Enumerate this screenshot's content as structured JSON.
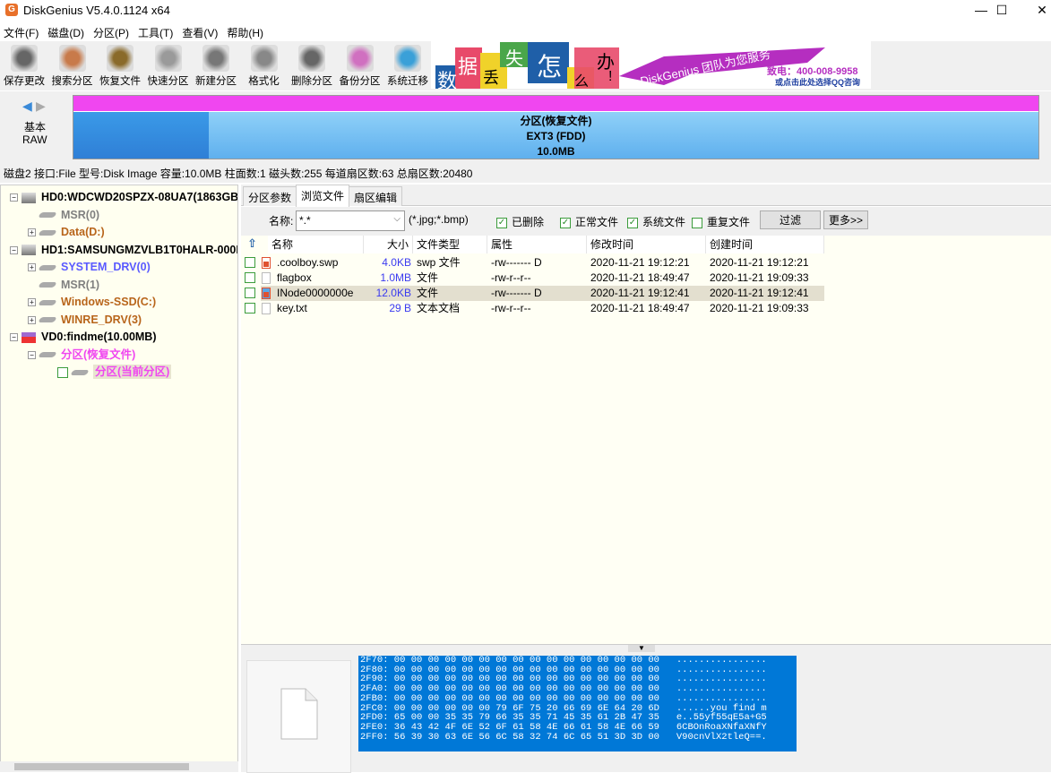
{
  "window": {
    "title": "DiskGenius V5.4.0.1124 x64",
    "logo": "G",
    "minimize": "—",
    "maximize": "☐",
    "close": "✕"
  },
  "menu": [
    "文件(F)",
    "磁盘(D)",
    "分区(P)",
    "工具(T)",
    "查看(V)",
    "帮助(H)"
  ],
  "toolbar": [
    {
      "label": "保存更改",
      "icon": "save-icon",
      "color": "#666"
    },
    {
      "label": "搜索分区",
      "icon": "search-icon",
      "color": "#c87a4a"
    },
    {
      "label": "恢复文件",
      "icon": "recover-icon",
      "color": "#8a6a2a"
    },
    {
      "label": "快速分区",
      "icon": "quick-partition-icon",
      "color": "#9a9a9a"
    },
    {
      "label": "新建分区",
      "icon": "new-partition-icon",
      "color": "#777"
    },
    {
      "label": "格式化",
      "icon": "format-icon",
      "color": "#888"
    },
    {
      "label": "删除分区",
      "icon": "delete-partition-icon",
      "color": "#666"
    },
    {
      "label": "备份分区",
      "icon": "backup-icon",
      "color": "#d070c0"
    },
    {
      "label": "系统迁移",
      "icon": "migrate-icon",
      "color": "#3aa0d8"
    }
  ],
  "banner": {
    "chars": [
      "数",
      "据",
      "丢",
      "失",
      "怎",
      "么",
      "办",
      "!"
    ],
    "slogan": "DiskGenius 团队为您服务",
    "phone": "致电：400-008-9958",
    "qq": "或点击此处选择QQ咨询"
  },
  "diskmap": {
    "type_line1": "基本",
    "type_line2": "RAW",
    "partition": "分区(恢复文件)",
    "fs": "EXT3 (FDD)",
    "size": "10.0MB",
    "color_strip": "#f046f0"
  },
  "diskinfo": "磁盘2 接口:File  型号:Disk Image  容量:10.0MB  柱面数:1  磁头数:255  每道扇区数:63  总扇区数:20480",
  "tree": [
    {
      "label": "HD0:WDCWD20SPZX-08UA7(1863GB)",
      "kind": "disk",
      "color": "#000"
    },
    {
      "label": "MSR(0)",
      "kind": "part",
      "color": "#808080"
    },
    {
      "label": "Data(D:)",
      "kind": "part",
      "color": "#b8651b"
    },
    {
      "label": "HD1:SAMSUNGMZVLB1T0HALR-000L7",
      "kind": "disk",
      "color": "#000"
    },
    {
      "label": "SYSTEM_DRV(0)",
      "kind": "part",
      "color": "#5a5aff"
    },
    {
      "label": "MSR(1)",
      "kind": "part",
      "color": "#808080"
    },
    {
      "label": "Windows-SSD(C:)",
      "kind": "part",
      "color": "#b8651b"
    },
    {
      "label": "WINRE_DRV(3)",
      "kind": "part",
      "color": "#b8651b"
    },
    {
      "label": "VD0:findme(10.00MB)",
      "kind": "vdisk",
      "color": "#000"
    },
    {
      "label": "分区(恢复文件)",
      "kind": "part",
      "color": "#f046f0"
    },
    {
      "label": "分区(当前分区)",
      "kind": "part",
      "color": "#f046f0"
    }
  ],
  "tabs": [
    "分区参数",
    "浏览文件",
    "扇区编辑"
  ],
  "filter": {
    "name_label": "名称:",
    "name_value": "*.*",
    "hint": "(*.jpg;*.bmp)",
    "checks": [
      {
        "label": "已删除",
        "checked": true
      },
      {
        "label": "正常文件",
        "checked": true
      },
      {
        "label": "系统文件",
        "checked": true
      },
      {
        "label": "重复文件",
        "checked": false
      }
    ],
    "filter_btn": "过滤",
    "more_btn": "更多>>"
  },
  "columns": [
    "名称",
    "大小",
    "文件类型",
    "属性",
    "修改时间",
    "创建时间"
  ],
  "files": [
    {
      "name": ".coolboy.swp",
      "size": "4.0KB",
      "type": "swp 文件",
      "attr": "-rw------- D",
      "mtime": "2020-11-21 19:12:21",
      "ctime": "2020-11-21 19:12:21",
      "deleted": true
    },
    {
      "name": "flagbox",
      "size": "1.0MB",
      "type": "文件",
      "attr": "-rw-r--r--",
      "mtime": "2020-11-21 18:49:47",
      "ctime": "2020-11-21 19:09:33",
      "deleted": false
    },
    {
      "name": "INode0000000e",
      "size": "12.0KB",
      "type": "文件",
      "attr": "-rw------- D",
      "mtime": "2020-11-21 19:12:41",
      "ctime": "2020-11-21 19:12:41",
      "deleted": true
    },
    {
      "name": "key.txt",
      "size": "29 B",
      "type": "文本文档",
      "attr": "-rw-r--r--",
      "mtime": "2020-11-21 18:49:47",
      "ctime": "2020-11-21 19:09:33",
      "deleted": false
    }
  ],
  "hex": [
    "2F70: 00 00 00 00 00 00 00 00 00 00 00 00 00 00 00 00   ................",
    "2F80: 00 00 00 00 00 00 00 00 00 00 00 00 00 00 00 00   ................",
    "2F90: 00 00 00 00 00 00 00 00 00 00 00 00 00 00 00 00   ................",
    "2FA0: 00 00 00 00 00 00 00 00 00 00 00 00 00 00 00 00   ................",
    "2FB0: 00 00 00 00 00 00 00 00 00 00 00 00 00 00 00 00   ................",
    "2FC0: 00 00 00 00 00 00 79 6F 75 20 66 69 6E 64 20 6D   ......you find m",
    "2FD0: 65 00 00 35 35 79 66 35 35 71 45 35 61 2B 47 35   e..55yf55qE5a+G5",
    "2FE0: 36 43 42 4F 6E 52 6F 61 58 4E 66 61 58 4E 66 59   6CBOnRoaXNfaXNfY",
    "2FF0: 56 39 30 63 6E 56 6C 58 32 74 6C 65 51 3D 3D 00   V90cnVlX2tleQ==."
  ]
}
